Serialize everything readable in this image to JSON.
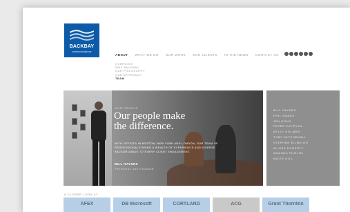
{
  "brand": {
    "name": "BACKBAY",
    "subtitle": "communications",
    "color": "#0d5aa8"
  },
  "nav": {
    "items": [
      "About",
      "What We Do",
      "Our Work",
      "Our Clients",
      "In The News",
      "Contact Us"
    ],
    "active": "About"
  },
  "social_icons": [
    "email-icon",
    "facebook-icon",
    "twitter-icon",
    "linkedin-icon",
    "blog-icon",
    "rss-icon"
  ],
  "subnav": {
    "items": [
      "Overview",
      "Why BackBay",
      "Our Philosophy",
      "Our Approach",
      "Team"
    ],
    "active": "Team"
  },
  "hero": {
    "label": "Our People",
    "headline_line1": "Our people make",
    "headline_line2": "the difference.",
    "body": "With offices in Boston, New York and London, our team of professionals bring a wealth of experience and diverse backgrounds to every client engagement.",
    "author": "BILL HAYNES",
    "role": "President and Founder"
  },
  "team": {
    "members": [
      "Bill Haynes",
      "Phil Nunes",
      "Jen Dong",
      "Peter Czyryca",
      "Kelly Holman",
      "Toby Mitchenall",
      "Stephen Kilmeigh",
      "Alissa Doherty",
      "Amanda Puglisi",
      "Miles Hill"
    ]
  },
  "clients": {
    "heading": "A Closer Look At",
    "logos": [
      "AFEX",
      "DB Microsoft",
      "CORTLAND",
      "ACG",
      "Grant Thornton"
    ]
  },
  "colors": {
    "team_panel": "#8f8f8f",
    "client_tile": "#b7cfe6"
  }
}
